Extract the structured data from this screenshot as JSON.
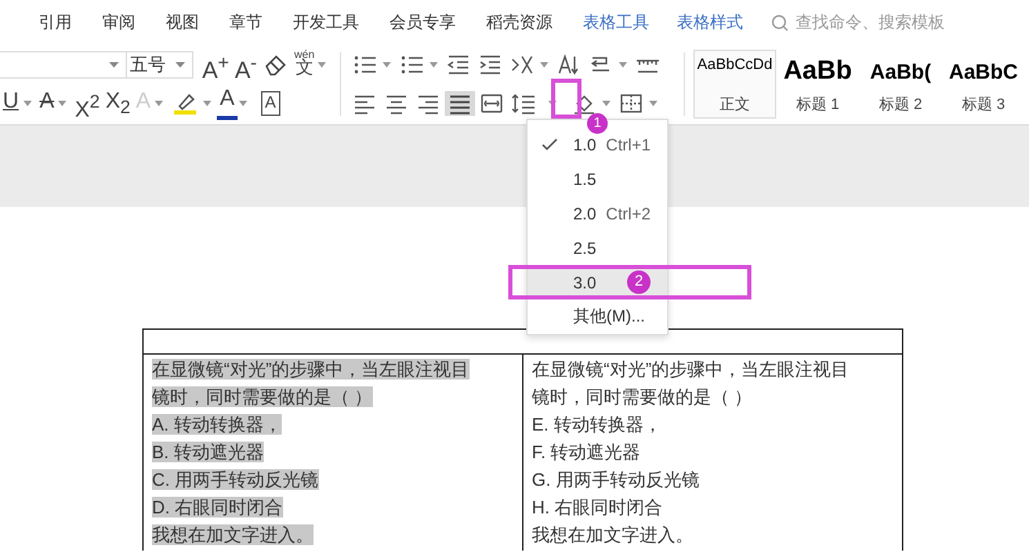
{
  "menu_tabs": [
    {
      "label": "引用",
      "kind": "menu"
    },
    {
      "label": "审阅",
      "kind": "menu"
    },
    {
      "label": "视图",
      "kind": "menu"
    },
    {
      "label": "章节",
      "kind": "menu"
    },
    {
      "label": "开发工具",
      "kind": "menu"
    },
    {
      "label": "会员专享",
      "kind": "menu"
    },
    {
      "label": "稻壳资源",
      "kind": "menu"
    },
    {
      "label": "表格工具",
      "kind": "context"
    },
    {
      "label": "表格样式",
      "kind": "context"
    }
  ],
  "search": {
    "placeholder": "查找命令、搜索模板"
  },
  "font_size": {
    "value": "五号"
  },
  "font_row1": [
    {
      "kind": "glyph",
      "text": "A$^{+}$",
      "dropdown": false
    },
    {
      "kind": "glyph",
      "text": "A$^{-}$",
      "dropdown": false
    },
    {
      "kind": "eraser",
      "dropdown": false
    },
    {
      "kind": "phonetic",
      "ruby": "wén",
      "text": "文",
      "dropdown": true
    }
  ],
  "font_row2": [
    {
      "kind": "underline",
      "text": "U",
      "dropdown": true
    },
    {
      "kind": "strike",
      "text": "A",
      "dropdown": true
    },
    {
      "kind": "glyph",
      "text": "X$^{2}$",
      "dropdown": false
    },
    {
      "kind": "glyph",
      "text": "X$_{2}$",
      "dropdown": false
    },
    {
      "kind": "outline",
      "text": "A",
      "dropdown": true
    },
    {
      "kind": "highlighter",
      "dropdown": true
    },
    {
      "kind": "fontcolor",
      "text": "A",
      "dropdown": true
    },
    {
      "kind": "boxed",
      "text": "A",
      "dropdown": false
    }
  ],
  "para_row1": [
    {
      "kind": "bullets",
      "dropdown": true,
      "selected": false
    },
    {
      "kind": "numbering",
      "dropdown": true,
      "selected": false
    },
    {
      "kind": "outdent",
      "dropdown": false,
      "selected": false
    },
    {
      "kind": "indent",
      "dropdown": false,
      "selected": false
    },
    {
      "kind": "layout",
      "dropdown": true,
      "selected": false
    },
    {
      "kind": "sort",
      "dropdown": false,
      "selected": false
    },
    {
      "kind": "marks",
      "dropdown": true,
      "selected": false
    },
    {
      "kind": "ruler",
      "dropdown": false,
      "selected": false
    }
  ],
  "para_row2": [
    {
      "kind": "align-left",
      "dropdown": false,
      "selected": false
    },
    {
      "kind": "align-center",
      "dropdown": false,
      "selected": false
    },
    {
      "kind": "align-right",
      "dropdown": false,
      "selected": false
    },
    {
      "kind": "justify",
      "dropdown": false,
      "selected": true
    },
    {
      "kind": "distribute",
      "dropdown": false,
      "selected": false
    },
    {
      "kind": "spacing",
      "dropdown": true,
      "selected": false
    },
    {
      "kind": "shading",
      "dropdown": true,
      "selected": false
    },
    {
      "kind": "borders",
      "dropdown": true,
      "selected": false
    }
  ],
  "styles": [
    {
      "preview": "AaBbCcDd",
      "label": "正文",
      "kind": "body",
      "selected": true
    },
    {
      "preview": "AaBb",
      "label": "标题 1",
      "kind": "h1",
      "selected": false
    },
    {
      "preview": "AaBb(",
      "label": "标题 2",
      "kind": "h2",
      "selected": false
    },
    {
      "preview": "AaBbC",
      "label": "标题 3",
      "kind": "h3",
      "selected": false
    }
  ],
  "spacing_menu": [
    {
      "label": "1.0",
      "shortcut": "Ctrl+1",
      "checked": true,
      "selected": false
    },
    {
      "label": "1.5",
      "checked": false,
      "selected": false
    },
    {
      "label": "2.0",
      "shortcut": "Ctrl+2",
      "checked": false,
      "selected": false
    },
    {
      "label": "2.5",
      "checked": false,
      "selected": false
    },
    {
      "label": "3.0",
      "checked": false,
      "selected": true
    },
    {
      "label": "其他(M)...",
      "checked": false,
      "selected": false
    }
  ],
  "annotations": [
    {
      "label": "1"
    },
    {
      "label": "2"
    }
  ],
  "table": {
    "cells": [
      {
        "selected": true,
        "lines": [
          "在显微镜“对光”的步骤中，当左眼注视目",
          "镜时，同时需要做的是（    ）",
          "A.  转动转换器，",
          "B.  转动遮光器",
          "C.  用两手转动反光镜",
          "D.  右眼同时闭合",
          "我想在加文字进入。"
        ]
      },
      {
        "selected": false,
        "lines": [
          "在显微镜“对光”的步骤中，当左眼注视目",
          "镜时，同时需要做的是（    ）",
          "E.  转动转换器，",
          "F.  转动遮光器",
          "G.  用两手转动反光镜",
          "H.  右眼同时闭合",
          "我想在加文字进入。"
        ]
      }
    ]
  }
}
